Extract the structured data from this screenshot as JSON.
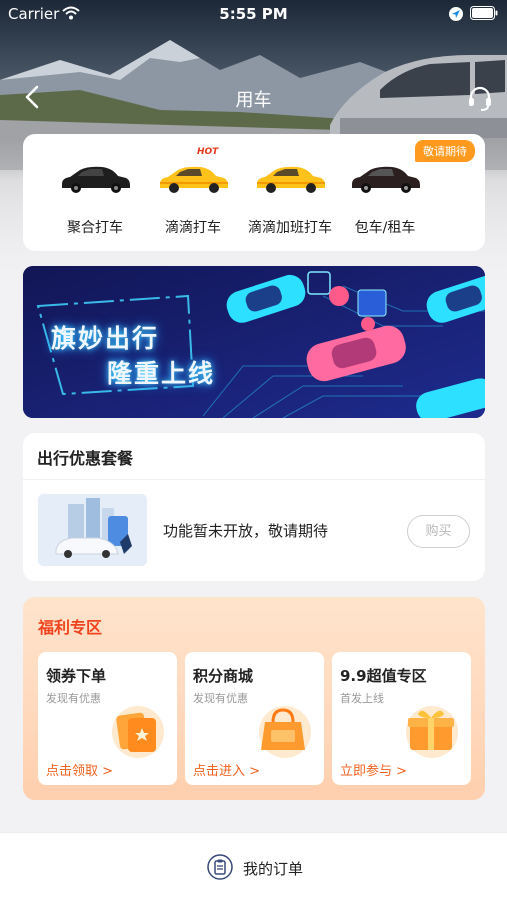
{
  "status_bar": {
    "carrier": "Carrier",
    "time": "5:55 PM"
  },
  "nav": {
    "title": "用车"
  },
  "ride_card": {
    "badge": "敬请期待",
    "options": [
      {
        "label": "聚合打车"
      },
      {
        "label": "滴滴打车",
        "badge": "HOT"
      },
      {
        "label": "滴滴加班打车"
      },
      {
        "label": "包车/租车"
      }
    ]
  },
  "banner": {
    "line1": "旗妙出行",
    "line2": "隆重上线"
  },
  "package": {
    "title": "出行优惠套餐",
    "message": "功能暂未开放，敬请期待",
    "buy_label": "购买"
  },
  "benefits": {
    "title": "福利专区",
    "tiles": [
      {
        "title": "领券下单",
        "subtitle": "发现有优惠",
        "link": "点击领取 >"
      },
      {
        "title": "积分商城",
        "subtitle": "发现有优惠",
        "link": "点击进入 >"
      },
      {
        "title": "9.9超值专区",
        "subtitle": "首发上线",
        "link": "立即参与 >"
      }
    ]
  },
  "bottom_bar": {
    "orders_label": "我的订单"
  },
  "colors": {
    "accent": "#f0621e",
    "badge": "#ff9a1f",
    "benefit_title": "#f0441e",
    "taxi_yellow": "#ffc21a"
  }
}
